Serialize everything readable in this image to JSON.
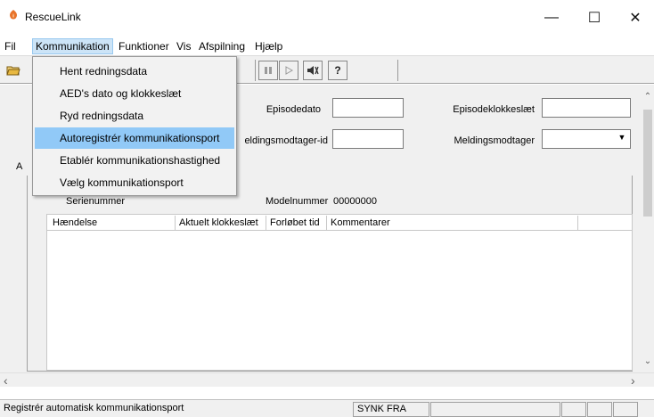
{
  "window": {
    "title": "RescueLink",
    "minimize": "—",
    "maximize": "☐",
    "close": "✕"
  },
  "menubar": [
    {
      "label": "Fil"
    },
    {
      "label": "Kommunikation"
    },
    {
      "label": "Funktioner"
    },
    {
      "label": "Vis"
    },
    {
      "label": "Afspilning"
    },
    {
      "label": "Hjælp"
    }
  ],
  "dropdown": {
    "items": [
      {
        "label": "Hent redningsdata"
      },
      {
        "label": "AED's dato og klokkeslæt"
      },
      {
        "label": "Ryd redningsdata"
      },
      {
        "label": "Autoregistrér kommunikationsport"
      },
      {
        "label": "Etablér kommunikationshastighed"
      },
      {
        "label": "Vælg kommunikationsport"
      }
    ],
    "highlighted_index": 3
  },
  "toolbar": {
    "icons": [
      "open-folder-icon",
      "pause-icon",
      "play-icon",
      "speaker-icon",
      "help-icon"
    ],
    "help_glyph": "?"
  },
  "fields": {
    "episodedato_label": "Episodedato",
    "episodedato_value": "",
    "episodeklokkeslaet_label": "Episodeklokkeslæt",
    "episodeklokkeslaet_value": "",
    "meldingsmodtager_id_label": "eldingsmodtager-id",
    "meldingsmodtager_id_value": "",
    "meldingsmodtager_label": "Meldingsmodtager",
    "meldingsmodtager_value": ""
  },
  "tab": {
    "fragment": "A"
  },
  "device": {
    "serienummer_label": "Serienummer",
    "modelnummer_label": "Modelnummer",
    "modelnummer_value": "00000000"
  },
  "table": {
    "columns": [
      "Hændelse",
      "Aktuelt klokkeslæt",
      "Forløbet tid",
      "Kommentarer"
    ],
    "rows": []
  },
  "statusbar": {
    "text": "Registrér automatisk kommunikationsport",
    "sync": "SYNK FRA"
  },
  "colors": {
    "menu_highlight": "#91c9f7",
    "menu_active": "#cce4f7"
  }
}
